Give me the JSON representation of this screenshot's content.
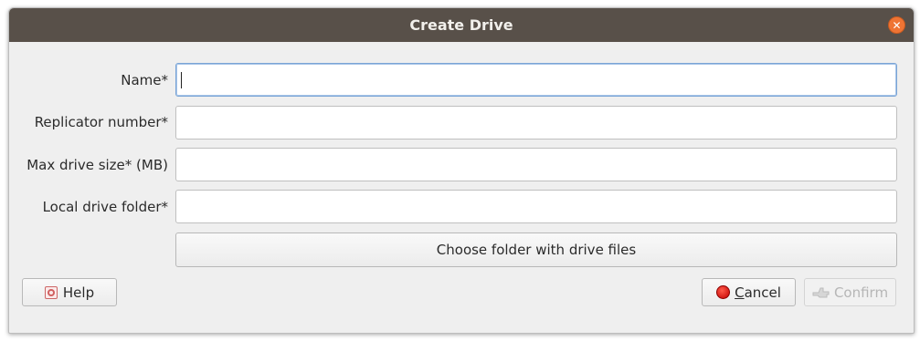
{
  "dialog": {
    "title": "Create Drive",
    "close_icon": "close-icon"
  },
  "form": {
    "name_label": "Name*",
    "name_value": "",
    "replicator_label": "Replicator number*",
    "replicator_value": "",
    "max_size_label": "Max drive size* (MB)",
    "max_size_value": "",
    "local_folder_label": "Local drive folder*",
    "local_folder_value": "",
    "choose_folder_label": "Choose folder with drive files"
  },
  "buttons": {
    "help_label": "Help",
    "cancel_mnemonic": "C",
    "cancel_rest": "ancel",
    "confirm_label": "Confirm"
  },
  "colors": {
    "titlebar": "#585049",
    "close": "#ef7434",
    "focus": "#7aa5d6"
  }
}
